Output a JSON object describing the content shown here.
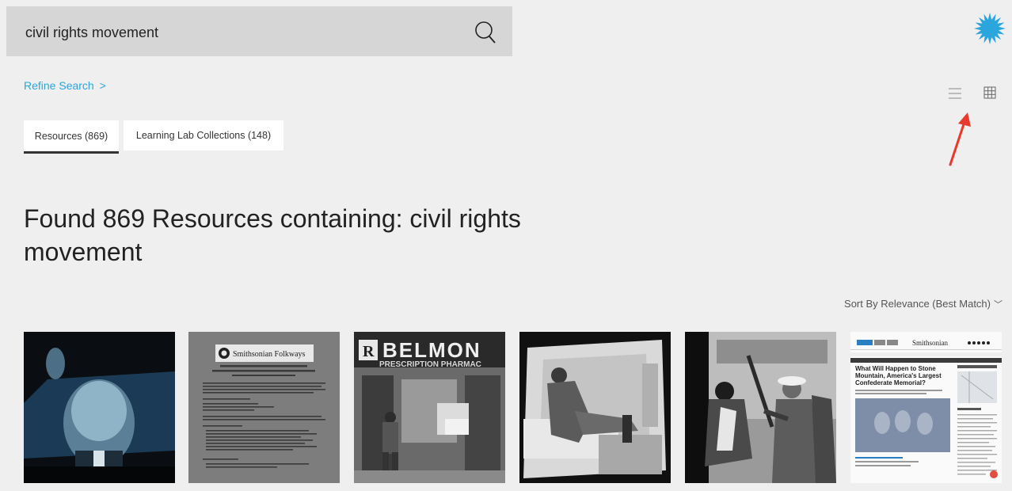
{
  "search": {
    "value": "civil rights movement",
    "placeholder": ""
  },
  "refine": {
    "label": "Refine Search",
    "chevron": ">"
  },
  "view_toggle": {
    "list_icon": "list-view-icon",
    "grid_icon": "grid-view-icon"
  },
  "tabs": [
    {
      "label": "Resources (869)",
      "active": true
    },
    {
      "label": "Learning Lab Collections (148)",
      "active": false
    }
  ],
  "results_heading": "Found 869 Resources containing: civil rights movement",
  "sort": {
    "label": "Sort By Relevance (Best Match)"
  },
  "thumbnails": {
    "doc_header": "Smithsonian Folkways",
    "storefront_sign": "BELMON",
    "storefront_subsign": "PRESCRIPTION PHARMAC",
    "storefront_badge": "R",
    "article_brand": "Smithsonian",
    "article_headline": "What Will Happen to Stone Mountain, America's Largest Confederate Memorial?"
  },
  "colors": {
    "accent": "#2aa6dc",
    "search_bg": "#d6d6d6",
    "page_bg": "#efefef",
    "arrow": "#e8392c"
  }
}
